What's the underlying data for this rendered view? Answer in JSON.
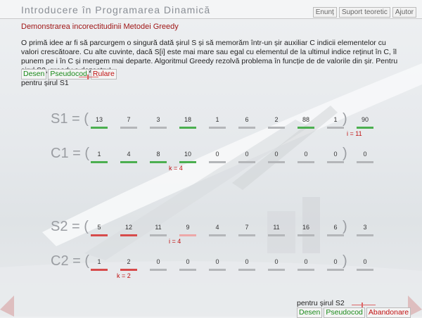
{
  "app": {
    "title": "Introducere în Programarea Dinamică"
  },
  "topnav": {
    "items": [
      "Enunț",
      "Suport teoretic",
      "Ajutor"
    ]
  },
  "section_title": "Demonstrarea incorectitudinii Metodei Greedy",
  "intro_text": "O primă idee ar fi să parcurgem o singură dată șirul S și să memorăm într-un șir auxiliar C indicii elementelor cu valori crescătoare. Cu alte cuvinte, dacă S[i] este mai mare sau egal cu elementul de la ultimul indice reținut în C, îl punem pe i în C și mergem mai departe. Algoritmul Greedy rezolvă problema în funcție de de valorile din șir. Pentru șirul S2, greedy e dezastru!",
  "controls1": {
    "desen": "Desen",
    "pseudocod": "Pseudocod",
    "rulare": "Rulare",
    "caption": "pentru șirul S1"
  },
  "rows": {
    "s1": {
      "label": "S1 = (",
      "close": ")",
      "values": [
        "13",
        "7",
        "3",
        "18",
        "1",
        "6",
        "2",
        "88",
        "1",
        "90"
      ],
      "marks": [
        "green",
        "gray",
        "gray",
        "green",
        "gray",
        "gray",
        "gray",
        "green",
        "gray",
        "green"
      ],
      "pointer": "i = 11"
    },
    "c1": {
      "label": "C1 = (",
      "close": ")",
      "values": [
        "1",
        "4",
        "8",
        "10",
        "0",
        "0",
        "0",
        "0",
        "0",
        "0"
      ],
      "marks": [
        "green",
        "green",
        "green",
        "green",
        "gray",
        "gray",
        "gray",
        "gray",
        "gray",
        "gray"
      ],
      "pointer": "k = 4"
    },
    "s2": {
      "label": "S2 = (",
      "close": ")",
      "values": [
        "5",
        "12",
        "11",
        "9",
        "4",
        "7",
        "11",
        "16",
        "6",
        "3"
      ],
      "marks": [
        "red",
        "red",
        "gray",
        "pink",
        "gray",
        "gray",
        "gray",
        "gray",
        "gray",
        "gray"
      ],
      "pointer": "i = 4"
    },
    "c2": {
      "label": "C2 = (",
      "close": ")",
      "values": [
        "1",
        "2",
        "0",
        "0",
        "0",
        "0",
        "0",
        "0",
        "0",
        "0"
      ],
      "marks": [
        "red",
        "red",
        "gray",
        "gray",
        "gray",
        "gray",
        "gray",
        "gray",
        "gray",
        "gray"
      ],
      "pointer": "k = 2"
    }
  },
  "controls2": {
    "caption": "pentru șirul S2",
    "desen": "Desen",
    "pseudocod": "Pseudocod",
    "abandonare": "Abandonare"
  }
}
